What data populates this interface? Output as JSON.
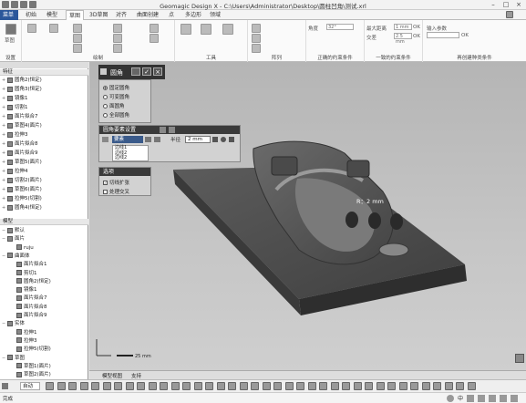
{
  "window": {
    "title": "Geomagic Design X - C:\\Users\\Administrator\\Desktop\\圆柱凹角\\测试.xrl"
  },
  "menu": {
    "tabs": [
      "菜单",
      "初始",
      "模型",
      "草图",
      "3D草图",
      "对齐",
      "曲面创建",
      "点",
      "多边形",
      "领域"
    ]
  },
  "ribbon": {
    "groups": [
      "设置",
      "绘制",
      "工具",
      "阵列",
      "正确的约束条件",
      "一致的约束条件",
      "再创建种类条件"
    ],
    "home_label": "草图",
    "angle_label": "角度",
    "angle_value": "32°",
    "max_dist_label": "最大距离",
    "max_dist_value": "1 mm",
    "intersect_label": "交差",
    "intersect_value": "2.5 mm",
    "input_param_label": "输入参数",
    "ok_label": "OK"
  },
  "left_panel": {
    "feature_header": "特征",
    "features": [
      "圆角2(恒定)",
      "圆角3(恒定)",
      "镜像1",
      "切割1",
      "面片拟合7",
      "草图4(面片)",
      "拉伸3",
      "面片拟合8",
      "面片拟合9",
      "草图5(面片)",
      "拉伸4",
      "切割2(面片)",
      "草图6(面片)",
      "拉伸5(切割)",
      "圆角4(恒定)"
    ],
    "model_header": "模型",
    "model_tree": [
      "默认",
      "面片",
      "ruju",
      "曲面体",
      "面片拟合1",
      "剪切1",
      "圆角2(恒定)",
      "镜像1",
      "面片拟合7",
      "面片拟合8",
      "面片拟合9",
      "实体",
      "拉伸1",
      "拉伸3",
      "拉伸5(切割)",
      "草图",
      "草图1(面片)",
      "草图2(面片)",
      "草图3(面片)"
    ]
  },
  "fillet_dialog": {
    "title": "圆角",
    "options": [
      "固定圆角",
      "可变圆角",
      "面圆角",
      "全部圆角"
    ],
    "selected_index": 0,
    "section_title": "圆角要素设置",
    "edge_label": "要素",
    "radius_label": "半径",
    "radius_value": "2 mm",
    "edges": [
      "边线1",
      "边线2",
      "边线2"
    ],
    "option_section": "选项",
    "tangent_expand": "切线扩张",
    "handle_intersection": "处理交叉"
  },
  "viewport": {
    "radius_annotation": "R：2 mm",
    "scale_label": "25 mm",
    "tabs": [
      "模型视图",
      "支持"
    ]
  },
  "statusbar": {
    "ready": "完成",
    "mode": "自动"
  },
  "colors": {
    "ribbon_blue": "#2b579a",
    "dialog_dark": "#3a3a3a",
    "model_dark": "#555555"
  }
}
